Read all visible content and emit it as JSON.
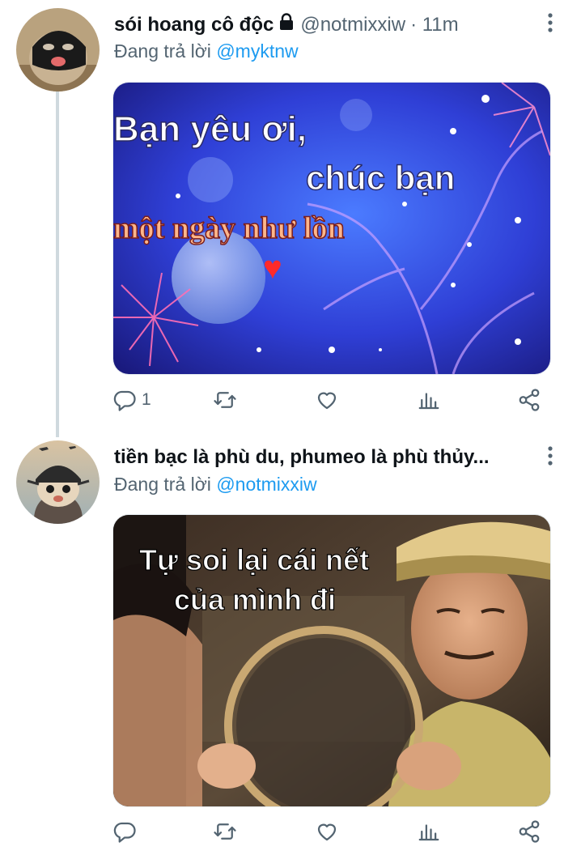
{
  "tweets": [
    {
      "display_name": "sói hoang cô độc",
      "handle": "@notmixxiw",
      "time": "· 11m",
      "protected": true,
      "replying_prefix": "Đang trả lời",
      "replying_to": "@myktnw",
      "media": {
        "line1": "Bạn yêu ơi,",
        "line2": "chúc bạn",
        "line3": "một ngày như lồn",
        "emoji": "♥"
      },
      "reply_count": "1"
    },
    {
      "display_name": "tiền bạc là phù du, phumeo là phù thủy...",
      "replying_prefix": "Đang trả lời",
      "replying_to": "@notmixxiw",
      "media": {
        "line1": "Tự soi lại cái nết",
        "line2": "của mình đi"
      },
      "reply_count": ""
    }
  ],
  "icons": [
    "reply-icon",
    "retweet-icon",
    "like-icon",
    "analytics-icon",
    "share-icon",
    "more-icon",
    "lock-icon"
  ],
  "colors": {
    "link": "#1d9bf0",
    "secondary": "#536471",
    "thread_line": "#cfd9de"
  }
}
